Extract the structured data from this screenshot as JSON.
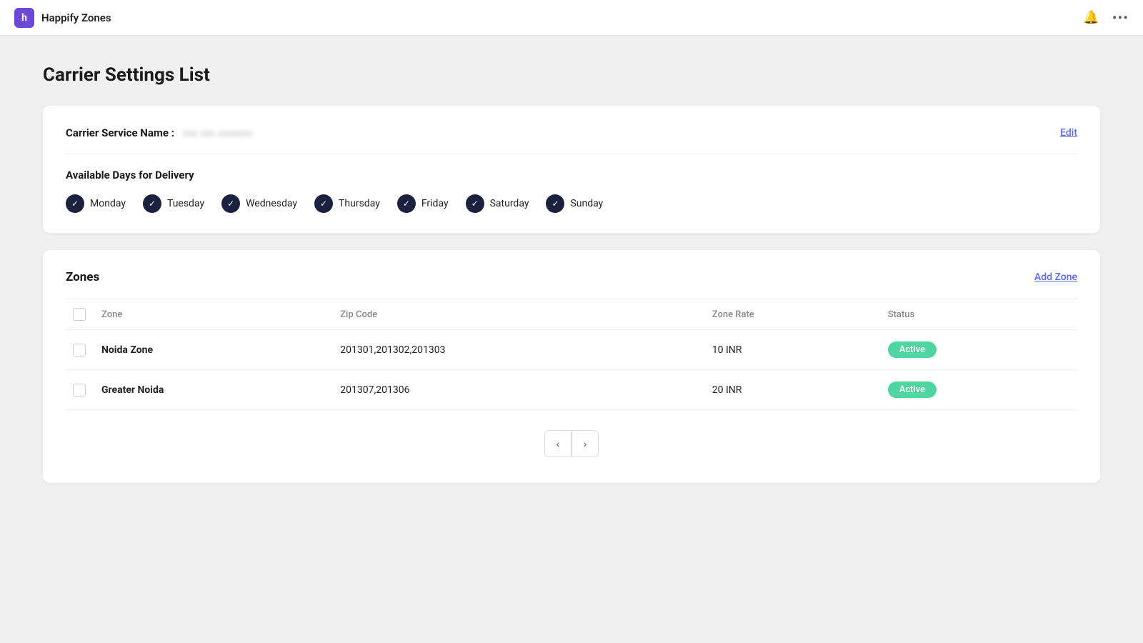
{
  "app": {
    "icon_letter": "h",
    "title": "Happify Zones"
  },
  "topnav": {
    "bell_icon": "🔔",
    "more_icon": "•••"
  },
  "page": {
    "title": "Carrier Settings List"
  },
  "carrier_service": {
    "label": "Carrier Service Name :",
    "name_value": "xxx xxx xxxxxxx",
    "edit_label": "Edit"
  },
  "delivery_days": {
    "section_title": "Available Days for Delivery",
    "days": [
      {
        "label": "Monday",
        "checked": true
      },
      {
        "label": "Tuesday",
        "checked": true
      },
      {
        "label": "Wednesday",
        "checked": true
      },
      {
        "label": "Thursday",
        "checked": true
      },
      {
        "label": "Friday",
        "checked": true
      },
      {
        "label": "Saturday",
        "checked": true
      },
      {
        "label": "Sunday",
        "checked": true
      }
    ]
  },
  "zones": {
    "section_title": "Zones",
    "add_zone_label": "Add Zone",
    "table": {
      "columns": [
        "Zone",
        "Zip Code",
        "Zone Rate",
        "Status"
      ],
      "rows": [
        {
          "name": "Noida Zone",
          "zip_code": "201301,201302,201303",
          "rate": "10 INR",
          "status": "Active"
        },
        {
          "name": "Greater Noida",
          "zip_code": "201307,201306",
          "rate": "20 INR",
          "status": "Active"
        }
      ]
    }
  },
  "pagination": {
    "prev_icon": "‹",
    "next_icon": "›"
  }
}
